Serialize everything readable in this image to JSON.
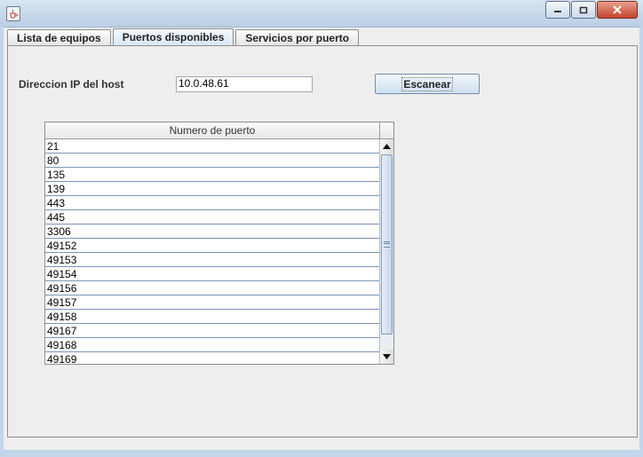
{
  "window": {
    "icon": "java-cup-icon"
  },
  "tabs": [
    {
      "label": "Lista de equipos",
      "active": false
    },
    {
      "label": "Puertos disponibles",
      "active": true
    },
    {
      "label": "Servicios por puerto",
      "active": false
    }
  ],
  "form": {
    "ip_label": "Direccion IP del host",
    "ip_value": "10.0.48.61",
    "scan_label": "Escanear"
  },
  "table": {
    "column_header": "Numero de puerto",
    "rows": [
      "21",
      "80",
      "135",
      "139",
      "443",
      "445",
      "3306",
      "49152",
      "49153",
      "49154",
      "49156",
      "49157",
      "49158",
      "49167",
      "49168",
      "49169"
    ]
  },
  "colors": {
    "accent": "#cfdff0",
    "close": "#c4432b"
  }
}
